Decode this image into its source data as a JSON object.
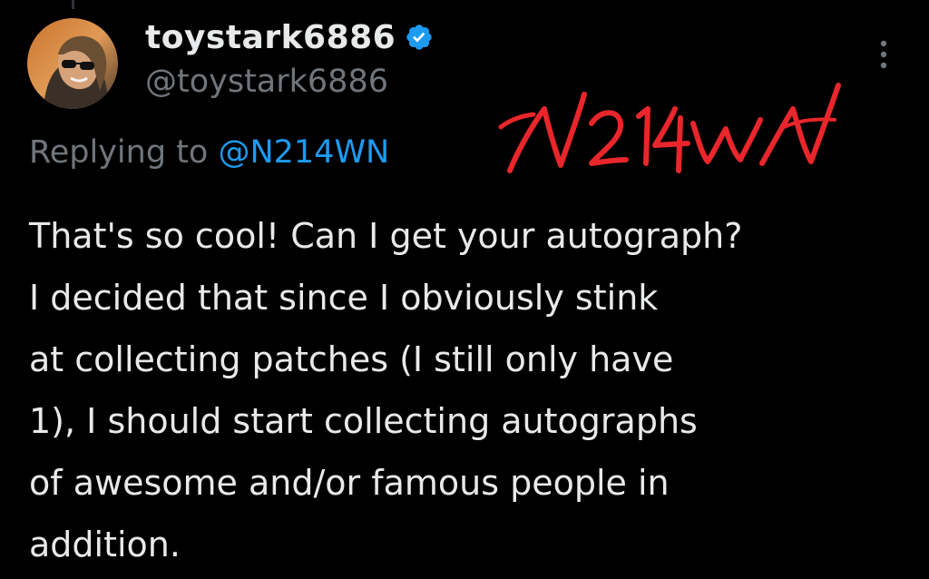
{
  "tweet": {
    "display_name": "toystark6886",
    "handle": "@toystark6886",
    "verified_icon": "verified-badge-icon",
    "more_icon": "more-options-icon",
    "replying_prefix": "Replying to ",
    "replying_to": "@N214WN",
    "signature_text": "N214WN",
    "body_lines": [
      "That's so cool! Can I get your autograph?",
      "I decided that since I obviously stink",
      "at collecting patches (I still only have",
      "1), I should start collecting autographs",
      "of awesome and/or famous people in",
      "addition."
    ]
  },
  "colors": {
    "background": "#000000",
    "primary_text": "#e7e9ea",
    "secondary_text": "#71767b",
    "link": "#1d9bf0",
    "verified": "#1d9bf0",
    "signature": "#e8262b"
  }
}
